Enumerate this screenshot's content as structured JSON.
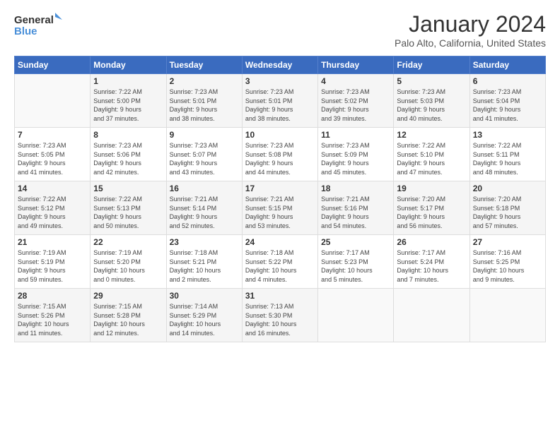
{
  "logo": {
    "text_general": "General",
    "text_blue": "Blue"
  },
  "header": {
    "month_year": "January 2024",
    "location": "Palo Alto, California, United States"
  },
  "days_of_week": [
    "Sunday",
    "Monday",
    "Tuesday",
    "Wednesday",
    "Thursday",
    "Friday",
    "Saturday"
  ],
  "weeks": [
    [
      {
        "day": "",
        "info": ""
      },
      {
        "day": "1",
        "info": "Sunrise: 7:22 AM\nSunset: 5:00 PM\nDaylight: 9 hours\nand 37 minutes."
      },
      {
        "day": "2",
        "info": "Sunrise: 7:23 AM\nSunset: 5:01 PM\nDaylight: 9 hours\nand 38 minutes."
      },
      {
        "day": "3",
        "info": "Sunrise: 7:23 AM\nSunset: 5:01 PM\nDaylight: 9 hours\nand 38 minutes."
      },
      {
        "day": "4",
        "info": "Sunrise: 7:23 AM\nSunset: 5:02 PM\nDaylight: 9 hours\nand 39 minutes."
      },
      {
        "day": "5",
        "info": "Sunrise: 7:23 AM\nSunset: 5:03 PM\nDaylight: 9 hours\nand 40 minutes."
      },
      {
        "day": "6",
        "info": "Sunrise: 7:23 AM\nSunset: 5:04 PM\nDaylight: 9 hours\nand 41 minutes."
      }
    ],
    [
      {
        "day": "7",
        "info": "Sunrise: 7:23 AM\nSunset: 5:05 PM\nDaylight: 9 hours\nand 41 minutes."
      },
      {
        "day": "8",
        "info": "Sunrise: 7:23 AM\nSunset: 5:06 PM\nDaylight: 9 hours\nand 42 minutes."
      },
      {
        "day": "9",
        "info": "Sunrise: 7:23 AM\nSunset: 5:07 PM\nDaylight: 9 hours\nand 43 minutes."
      },
      {
        "day": "10",
        "info": "Sunrise: 7:23 AM\nSunset: 5:08 PM\nDaylight: 9 hours\nand 44 minutes."
      },
      {
        "day": "11",
        "info": "Sunrise: 7:23 AM\nSunset: 5:09 PM\nDaylight: 9 hours\nand 45 minutes."
      },
      {
        "day": "12",
        "info": "Sunrise: 7:22 AM\nSunset: 5:10 PM\nDaylight: 9 hours\nand 47 minutes."
      },
      {
        "day": "13",
        "info": "Sunrise: 7:22 AM\nSunset: 5:11 PM\nDaylight: 9 hours\nand 48 minutes."
      }
    ],
    [
      {
        "day": "14",
        "info": "Sunrise: 7:22 AM\nSunset: 5:12 PM\nDaylight: 9 hours\nand 49 minutes."
      },
      {
        "day": "15",
        "info": "Sunrise: 7:22 AM\nSunset: 5:13 PM\nDaylight: 9 hours\nand 50 minutes."
      },
      {
        "day": "16",
        "info": "Sunrise: 7:21 AM\nSunset: 5:14 PM\nDaylight: 9 hours\nand 52 minutes."
      },
      {
        "day": "17",
        "info": "Sunrise: 7:21 AM\nSunset: 5:15 PM\nDaylight: 9 hours\nand 53 minutes."
      },
      {
        "day": "18",
        "info": "Sunrise: 7:21 AM\nSunset: 5:16 PM\nDaylight: 9 hours\nand 54 minutes."
      },
      {
        "day": "19",
        "info": "Sunrise: 7:20 AM\nSunset: 5:17 PM\nDaylight: 9 hours\nand 56 minutes."
      },
      {
        "day": "20",
        "info": "Sunrise: 7:20 AM\nSunset: 5:18 PM\nDaylight: 9 hours\nand 57 minutes."
      }
    ],
    [
      {
        "day": "21",
        "info": "Sunrise: 7:19 AM\nSunset: 5:19 PM\nDaylight: 9 hours\nand 59 minutes."
      },
      {
        "day": "22",
        "info": "Sunrise: 7:19 AM\nSunset: 5:20 PM\nDaylight: 10 hours\nand 0 minutes."
      },
      {
        "day": "23",
        "info": "Sunrise: 7:18 AM\nSunset: 5:21 PM\nDaylight: 10 hours\nand 2 minutes."
      },
      {
        "day": "24",
        "info": "Sunrise: 7:18 AM\nSunset: 5:22 PM\nDaylight: 10 hours\nand 4 minutes."
      },
      {
        "day": "25",
        "info": "Sunrise: 7:17 AM\nSunset: 5:23 PM\nDaylight: 10 hours\nand 5 minutes."
      },
      {
        "day": "26",
        "info": "Sunrise: 7:17 AM\nSunset: 5:24 PM\nDaylight: 10 hours\nand 7 minutes."
      },
      {
        "day": "27",
        "info": "Sunrise: 7:16 AM\nSunset: 5:25 PM\nDaylight: 10 hours\nand 9 minutes."
      }
    ],
    [
      {
        "day": "28",
        "info": "Sunrise: 7:15 AM\nSunset: 5:26 PM\nDaylight: 10 hours\nand 11 minutes."
      },
      {
        "day": "29",
        "info": "Sunrise: 7:15 AM\nSunset: 5:28 PM\nDaylight: 10 hours\nand 12 minutes."
      },
      {
        "day": "30",
        "info": "Sunrise: 7:14 AM\nSunset: 5:29 PM\nDaylight: 10 hours\nand 14 minutes."
      },
      {
        "day": "31",
        "info": "Sunrise: 7:13 AM\nSunset: 5:30 PM\nDaylight: 10 hours\nand 16 minutes."
      },
      {
        "day": "",
        "info": ""
      },
      {
        "day": "",
        "info": ""
      },
      {
        "day": "",
        "info": ""
      }
    ]
  ]
}
